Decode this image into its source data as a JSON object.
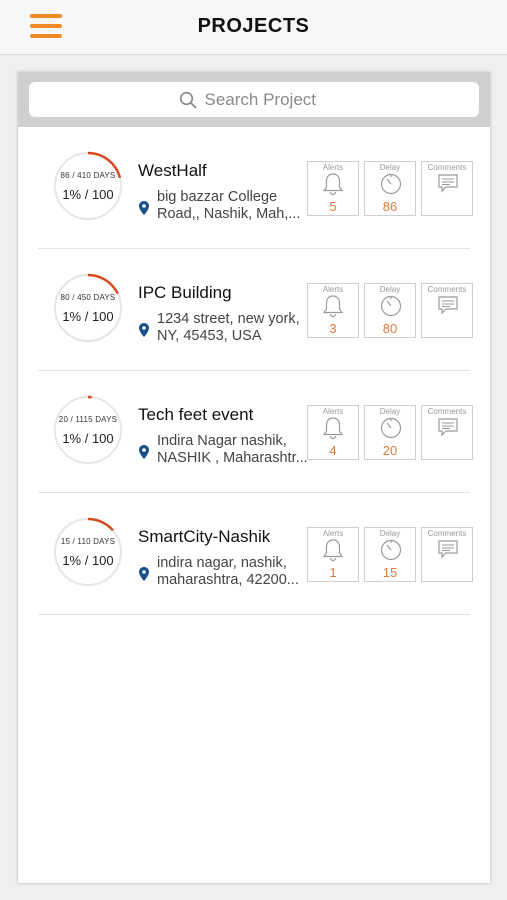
{
  "header": {
    "title": "PROJECTS",
    "menu_icon": "hamburger-menu-icon"
  },
  "colors": {
    "accent": "#f08a24",
    "value": "#e07b3a",
    "ring_track": "#e6e6e6",
    "ring_progress": "#d64a1f"
  },
  "search": {
    "placeholder": "Search Project",
    "value": ""
  },
  "projects": [
    {
      "days": "86 / 410 DAYS",
      "days_elapsed": 86,
      "days_total": 410,
      "percent": "1% / 100",
      "name": "WestHalf",
      "address_line1": "big bazzar College",
      "address_line2": "Road,, Nashik, Mah,...",
      "alerts_label": "Alerts",
      "alerts": "5",
      "delay_label": "Delay",
      "delay": "86",
      "comments_label": "Comments"
    },
    {
      "days": "80 / 450 DAYS",
      "days_elapsed": 80,
      "days_total": 450,
      "percent": "1% / 100",
      "name": "IPC Building",
      "address_line1": "1234 street, new york,",
      "address_line2": "NY, 45453, USA",
      "alerts_label": "Alerts",
      "alerts": "3",
      "delay_label": "Delay",
      "delay": "80",
      "comments_label": "Comments"
    },
    {
      "days": "20 / 1115 DAYS",
      "days_elapsed": 20,
      "days_total": 1115,
      "percent": "1% / 100",
      "name": "Tech feet event",
      "address_line1": "Indira Nagar nashik,",
      "address_line2": "NASHIK , Maharashtr...",
      "alerts_label": "Alerts",
      "alerts": "4",
      "delay_label": "Delay",
      "delay": "20",
      "comments_label": "Comments"
    },
    {
      "days": "15 / 110 DAYS",
      "days_elapsed": 15,
      "days_total": 110,
      "percent": "1% / 100",
      "name": "SmartCity-Nashik",
      "address_line1": "indira nagar, nashik,",
      "address_line2": "maharashtra, 42200...",
      "alerts_label": "Alerts",
      "alerts": "1",
      "delay_label": "Delay",
      "delay": "15",
      "comments_label": "Comments"
    }
  ]
}
